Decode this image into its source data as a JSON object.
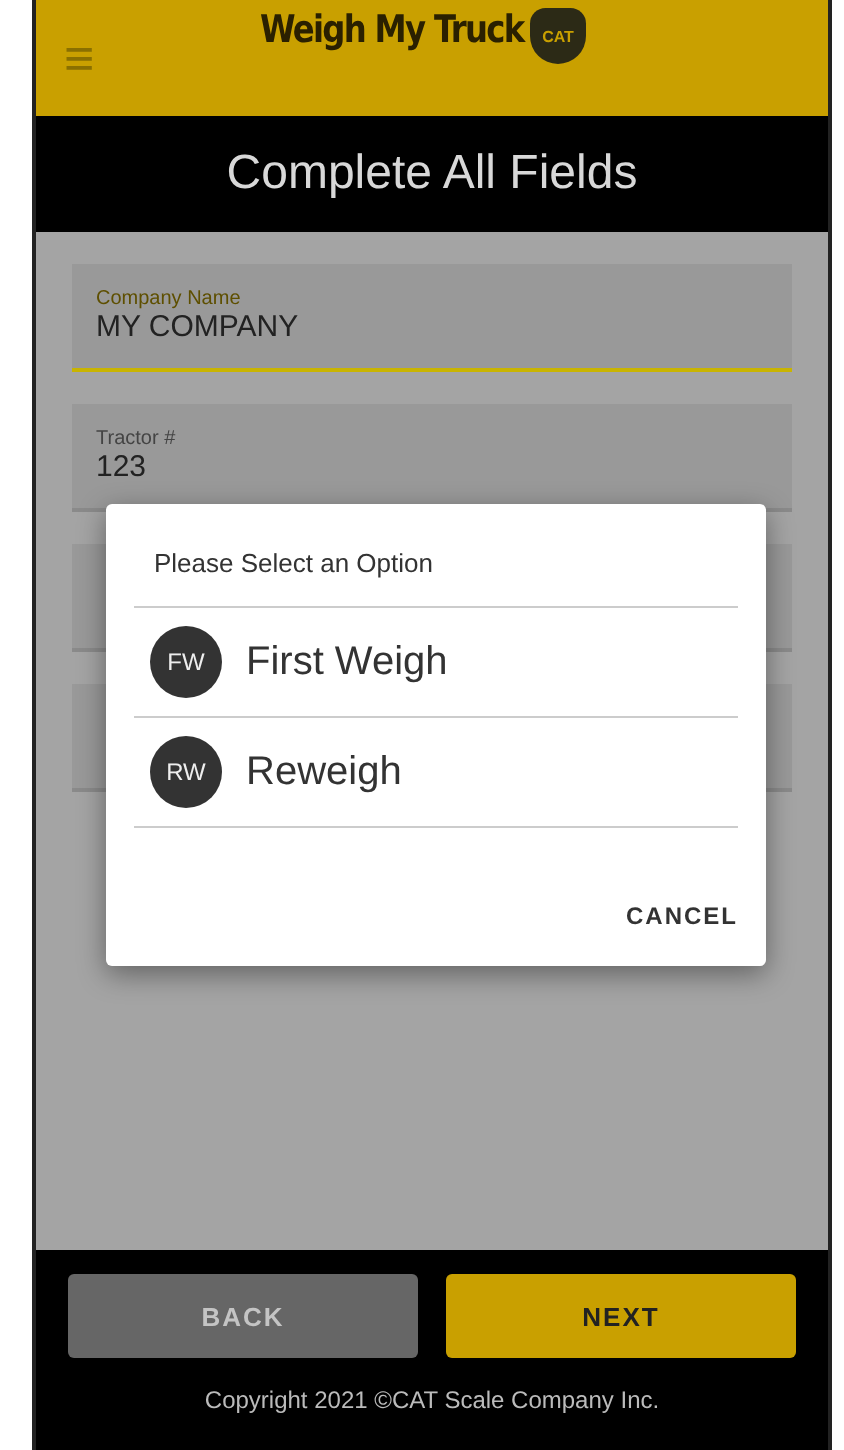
{
  "header": {
    "menu_icon": "≡",
    "logo_text": "Weigh My Truck",
    "logo_badge": "CAT"
  },
  "title": "Complete All Fields",
  "fields": [
    {
      "label": "Company Name",
      "value": "MY COMPANY",
      "focused": true
    },
    {
      "label": "Tractor #",
      "value": "123",
      "focused": false
    },
    {
      "focused": false
    },
    {
      "focused": false
    }
  ],
  "dialog": {
    "title": "Please Select an Option",
    "options": [
      {
        "initials": "FW",
        "label": "First Weigh"
      },
      {
        "initials": "RW",
        "label": "Reweigh"
      }
    ],
    "cancel": "CANCEL"
  },
  "buttons": [
    {
      "label": "BACK",
      "disabled": true
    },
    {
      "label": "NEXT",
      "disabled": false
    }
  ],
  "footer": "Copyright 2021 ©CAT Scale Company Inc."
}
